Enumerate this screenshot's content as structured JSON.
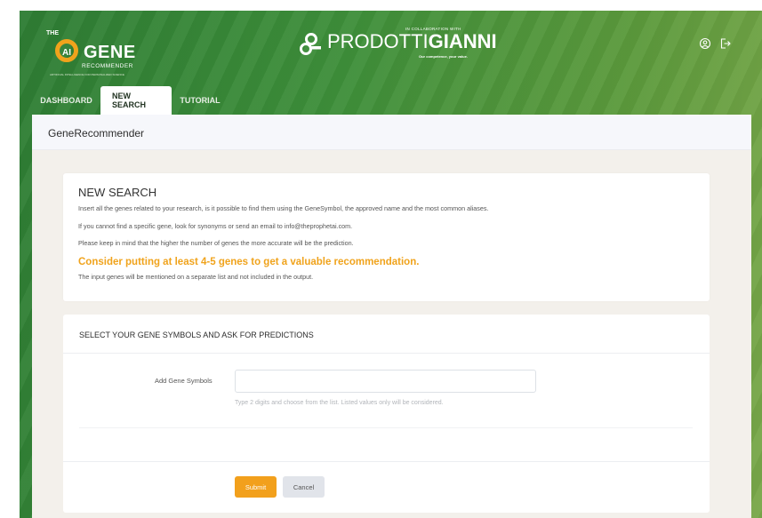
{
  "brand": {
    "logo_the": "THE",
    "logo_ai": "AI",
    "logo_gene": "GENE",
    "logo_recommender": "RECOMMENDER",
    "logo_tagline": "ARTIFICIAL INTELLIGENCE FOR PERSONALIZED SCIENCE",
    "accent_color": "#f0a31c",
    "header_green": "#3e8f3a"
  },
  "partner": {
    "collab": "IN COLLABORATION WITH",
    "name_light": "PRODOTTI",
    "name_bold": "GIANNI",
    "tagline": "Our competence, your value."
  },
  "header_icons": [
    "user-icon",
    "logout-icon"
  ],
  "tabs": [
    {
      "label": "DASHBOARD",
      "active": false
    },
    {
      "label": "NEW SEARCH",
      "active": true
    },
    {
      "label": "TUTORIAL",
      "active": false
    }
  ],
  "page_title": "GeneRecommender",
  "intro": {
    "heading": "NEW SEARCH",
    "line1": "Insert all the genes related to your research, is it possible to find them using the GeneSymbol, the approved name and the most common aliases.",
    "line2": "If you cannot find a specific gene, look for synonyms or send an email to info@theprophetai.com.",
    "line3": "Please keep in mind that the higher the number of genes the more accurate will be the prediction.",
    "highlight": "Consider putting at least 4-5 genes to get a valuable recommendation.",
    "line4": "The input genes will be mentioned on a separate list and not included in the output."
  },
  "form": {
    "heading": "SELECT YOUR GENE SYMBOLS AND ASK FOR PREDICTIONS",
    "field_label": "Add Gene Symbols",
    "field_value": "",
    "field_help": "Type 2 digits and choose from the list. Listed values only will be considered.",
    "submit_label": "Submit",
    "cancel_label": "Cancel"
  }
}
